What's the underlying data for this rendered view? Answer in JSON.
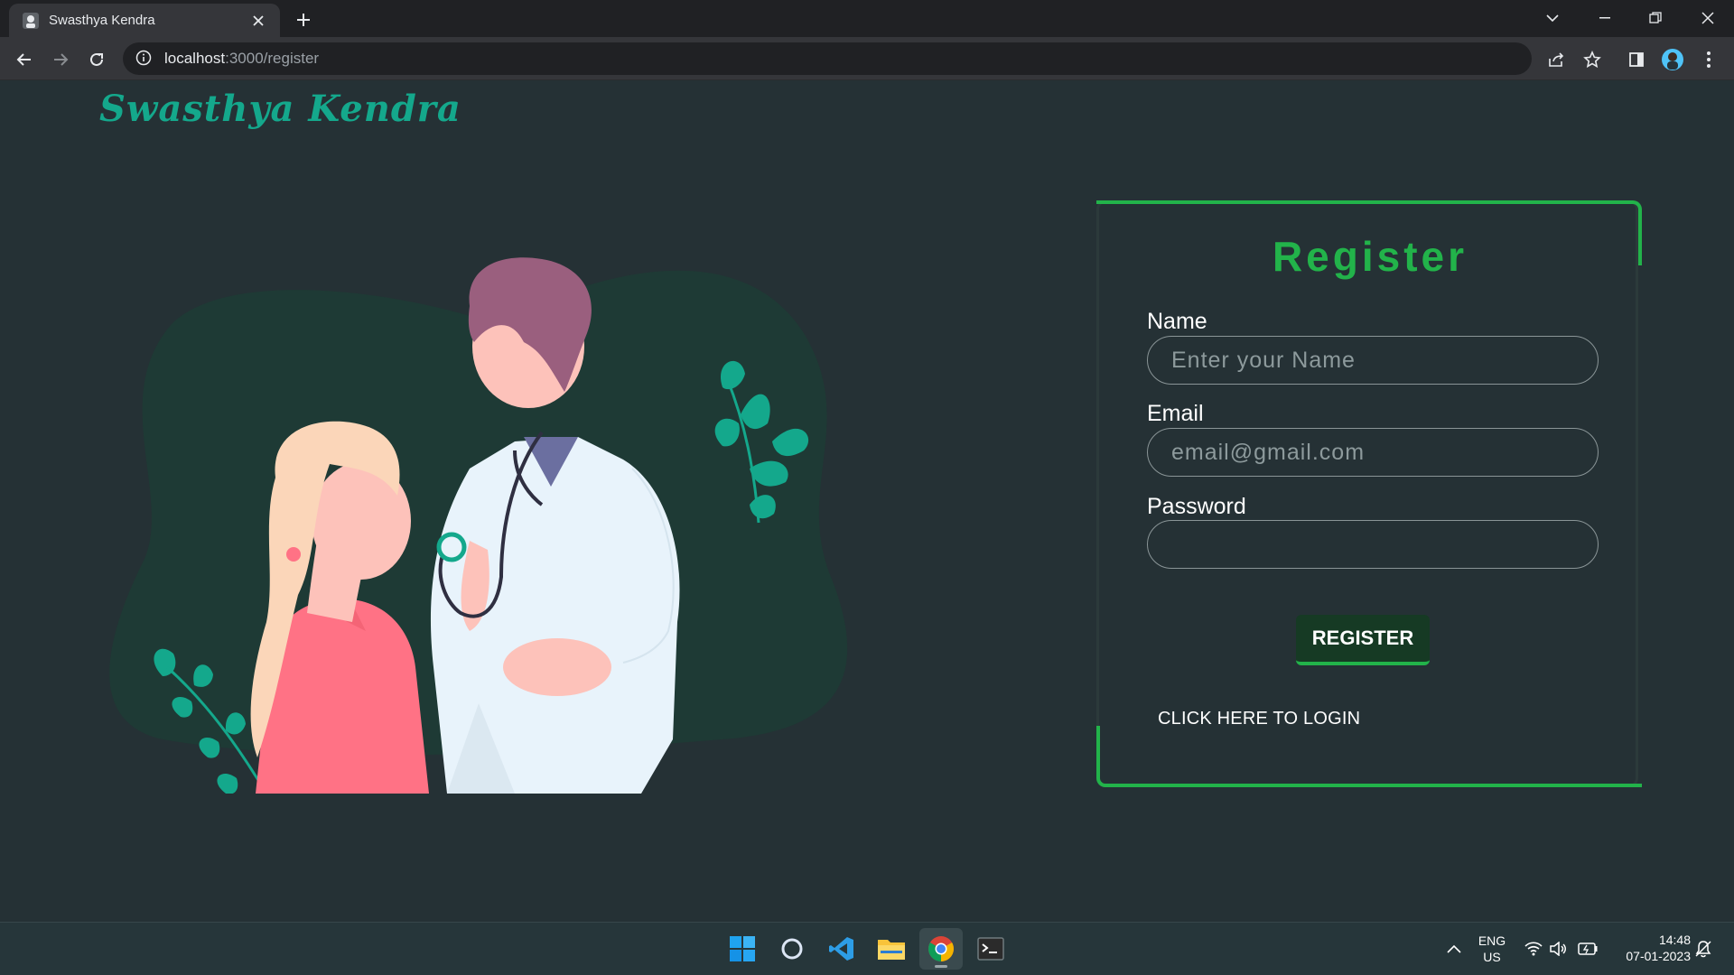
{
  "browser": {
    "tab_title": "Swasthya Kendra",
    "url_host": "localhost",
    "url_path": ":3000/register"
  },
  "page": {
    "brand": "Swasthya Kendra",
    "form": {
      "title": "Register",
      "name_label": "Name",
      "name_placeholder": "Enter your Name",
      "email_label": "Email",
      "email_placeholder": "email@gmail.com",
      "password_label": "Password",
      "password_placeholder": "",
      "submit_label": "REGISTER",
      "login_link": "CLICK HERE TO LOGIN"
    }
  },
  "taskbar": {
    "lang_top": "ENG",
    "lang_bottom": "US",
    "time": "14:48",
    "date": "07-01-2023"
  },
  "colors": {
    "page_bg": "#253135",
    "accent": "#22b34a",
    "brand": "#14a88c"
  }
}
